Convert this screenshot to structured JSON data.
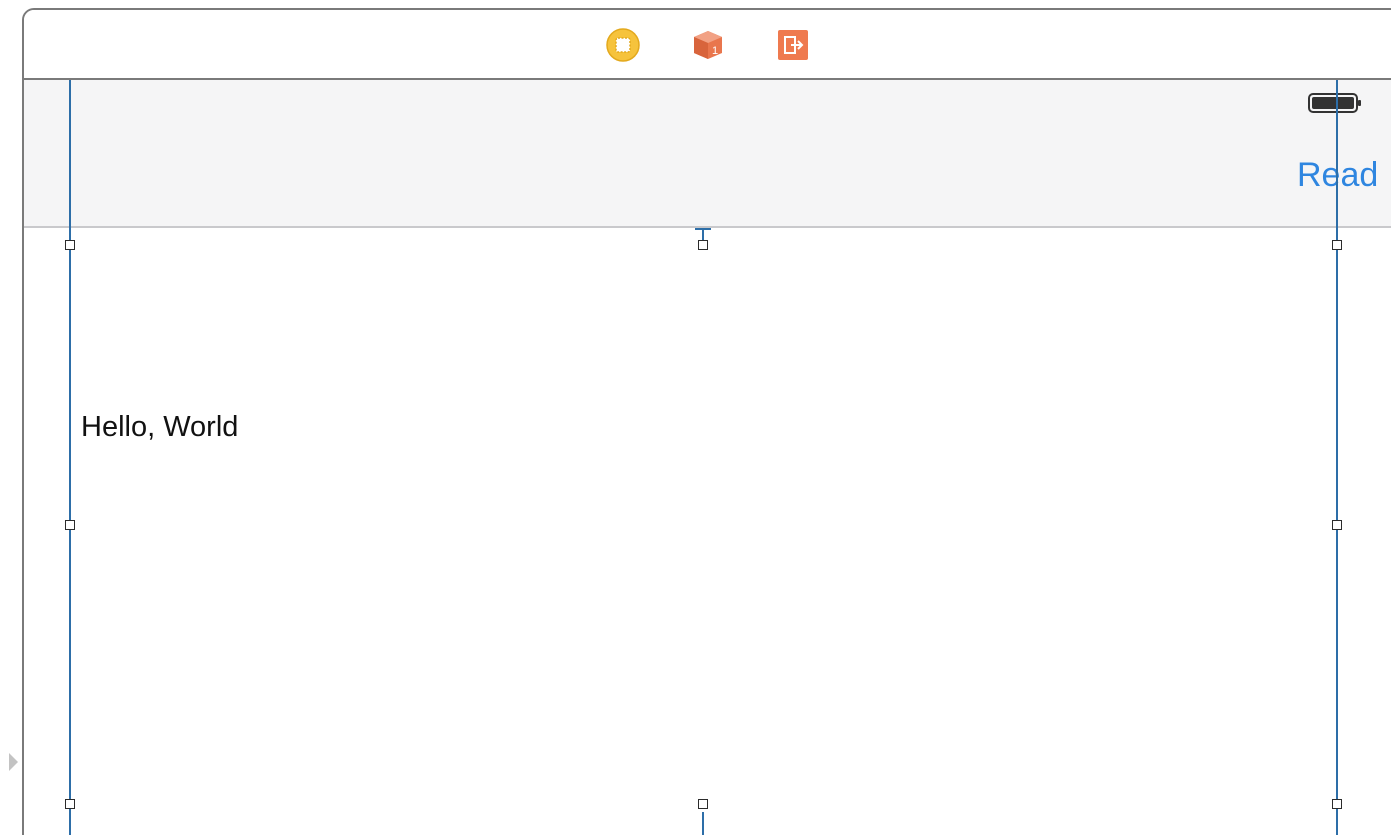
{
  "scene_dock": {
    "icons": [
      {
        "name": "view-controller-icon",
        "color": "#f6c33c"
      },
      {
        "name": "first-responder-icon",
        "color": "#e9764d",
        "badge": "1"
      },
      {
        "name": "exit-icon",
        "color": "#ef7a4f"
      }
    ]
  },
  "nav_bar": {
    "right_button_label": "Read",
    "battery_icon": "battery-icon"
  },
  "content": {
    "label_text": "Hello, World"
  },
  "colors": {
    "accent": "#2f86e0",
    "guide": "#2d6ea8",
    "nav_background": "#f5f5f6"
  }
}
